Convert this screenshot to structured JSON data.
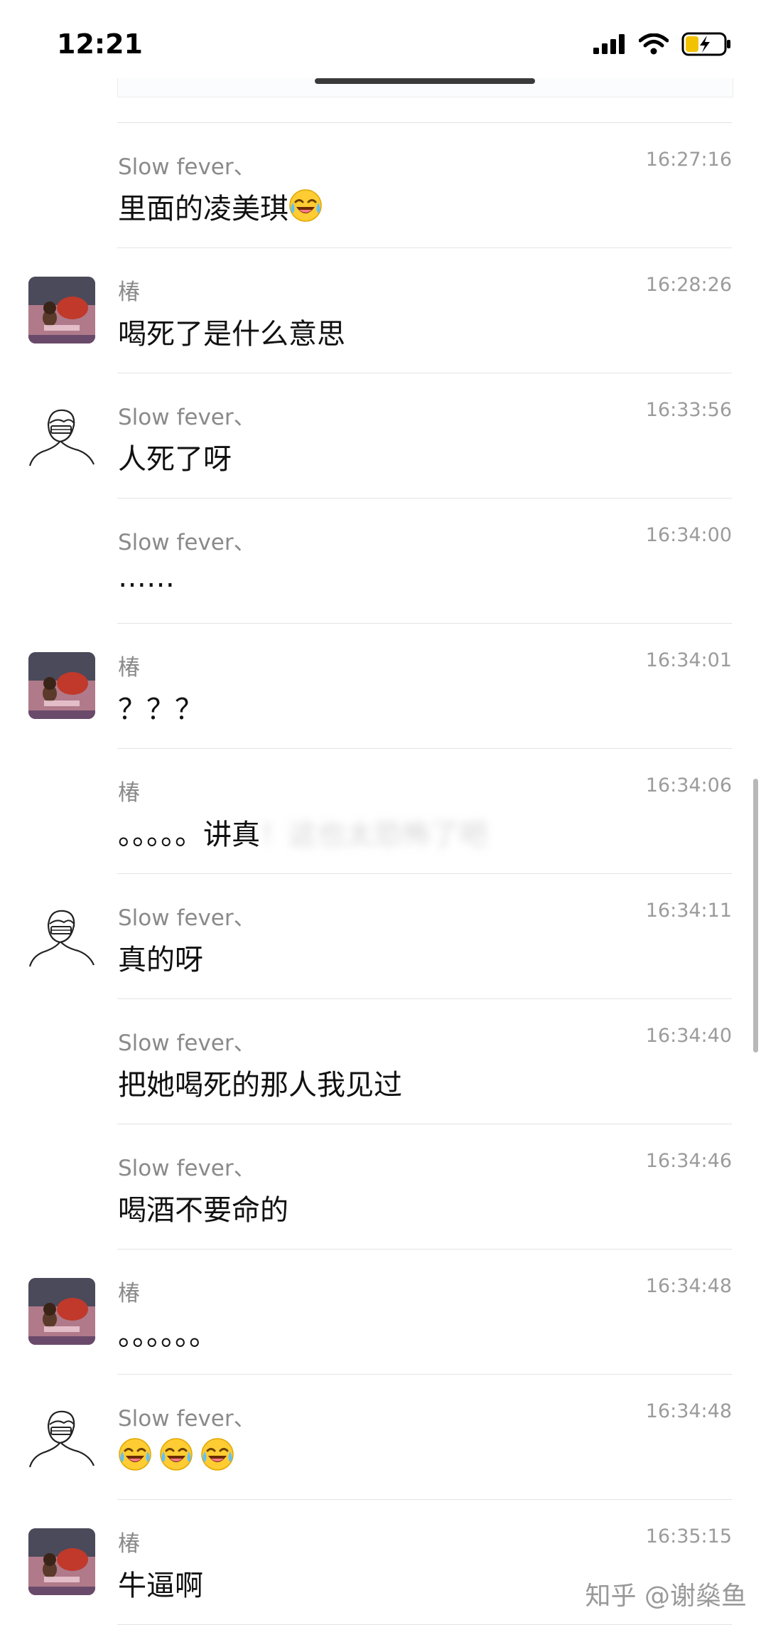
{
  "status_bar": {
    "time": "12:21",
    "signal_icon": "cellular-signal-icon",
    "wifi_icon": "wifi-icon",
    "battery_icon": "battery-charging-icon"
  },
  "messages": [
    {
      "sender": "Slow fever、",
      "time": "16:27:16",
      "text": "里面的凌美琪",
      "emoji_count": 1,
      "avatar": "none"
    },
    {
      "sender": "椿",
      "time": "16:28:26",
      "text": "喝死了是什么意思",
      "emoji_count": 0,
      "avatar": "photo"
    },
    {
      "sender": "Slow fever、",
      "time": "16:33:56",
      "text": "人死了呀",
      "emoji_count": 0,
      "avatar": "sketch"
    },
    {
      "sender": "Slow fever、",
      "time": "16:34:00",
      "text": "……",
      "emoji_count": 0,
      "avatar": "none"
    },
    {
      "sender": "椿",
      "time": "16:34:01",
      "text": "？？？",
      "emoji_count": 0,
      "avatar": "photo"
    },
    {
      "sender": "椿",
      "time": "16:34:06",
      "text": "。。。。。讲真",
      "blurred_text": "！这也太恐怖了吧",
      "emoji_count": 0,
      "avatar": "none"
    },
    {
      "sender": "Slow fever、",
      "time": "16:34:11",
      "text": "真的呀",
      "emoji_count": 0,
      "avatar": "sketch"
    },
    {
      "sender": "Slow fever、",
      "time": "16:34:40",
      "text": "把她喝死的那人我见过",
      "emoji_count": 0,
      "avatar": "none"
    },
    {
      "sender": "Slow fever、",
      "time": "16:34:46",
      "text": "喝酒不要命的",
      "emoji_count": 0,
      "avatar": "none"
    },
    {
      "sender": "椿",
      "time": "16:34:48",
      "text": "。。。。。。",
      "emoji_count": 0,
      "avatar": "photo"
    },
    {
      "sender": "Slow fever、",
      "time": "16:34:48",
      "text": "",
      "emoji_count": 3,
      "avatar": "sketch"
    },
    {
      "sender": "椿",
      "time": "16:35:15",
      "text": "牛逼啊",
      "emoji_count": 0,
      "avatar": "photo"
    }
  ],
  "emoji_name": "tears-of-joy-emoji-icon",
  "watermark": "知乎 @谢燊鱼"
}
